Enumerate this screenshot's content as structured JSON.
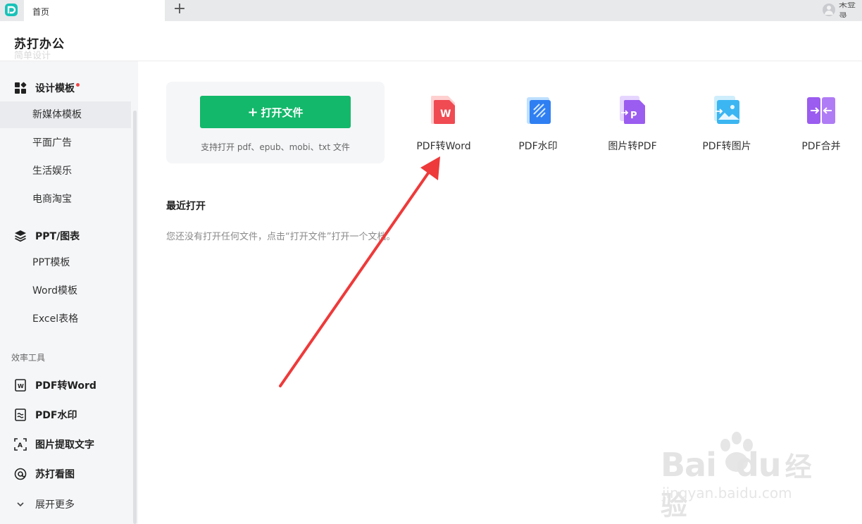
{
  "tabbar": {
    "tab_label": "首页",
    "add_tab": "+",
    "user_label": "未登录"
  },
  "header": {
    "app_title": "苏打办公",
    "faded_text": "简单设计"
  },
  "sidebar": {
    "design": {
      "label": "设计模板",
      "items": [
        "新媒体模板",
        "平面广告",
        "生活娱乐",
        "电商淘宝"
      ]
    },
    "ppt": {
      "label": "PPT/图表",
      "items": [
        "PPT模板",
        "Word模板",
        "Excel表格"
      ]
    },
    "tools_group_label": "效率工具",
    "tools": [
      "PDF转Word",
      "PDF水印",
      "图片提取文字",
      "苏打看图"
    ],
    "expand_label": "展开更多"
  },
  "main": {
    "open_button": "打开文件",
    "open_plus": "+",
    "open_hint": "支持打开 pdf、epub、mobi、txt 文件",
    "tools": [
      "PDF转Word",
      "PDF水印",
      "图片转PDF",
      "PDF转图片",
      "PDF合并"
    ],
    "recent_title": "最近打开",
    "recent_empty": "您还没有打开任何文件，点击“打开文件”打开一个文档。"
  },
  "watermark": {
    "logo_text": "Bai",
    "logo_text2": "du",
    "logo_cn": "经验",
    "url": "jingyan.baidu.com"
  },
  "colors": {
    "accent": "#13b86a",
    "arrow": "#ee3a3a",
    "badge": "#f04545"
  }
}
